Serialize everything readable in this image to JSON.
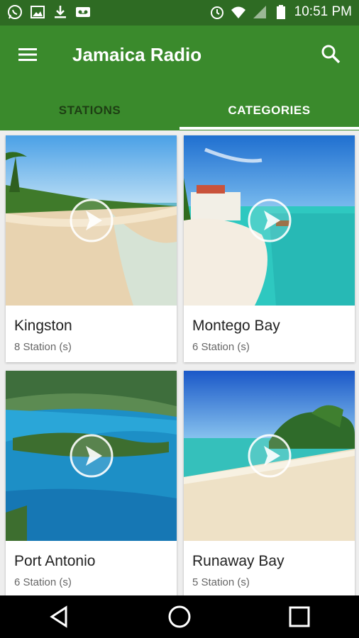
{
  "status_bar": {
    "time": "10:51 PM",
    "left_icons": [
      "whatsapp-icon",
      "gallery-icon",
      "download-icon",
      "voicemail-icon"
    ],
    "right_icons": [
      "alarm-icon",
      "wifi-icon",
      "signal-icon",
      "battery-icon"
    ]
  },
  "app_bar": {
    "title": "Jamaica Radio",
    "menu_icon": "menu-icon",
    "search_icon": "search-icon"
  },
  "tabs": [
    {
      "label": "STATIONS",
      "active": false
    },
    {
      "label": "CATEGORIES",
      "active": true
    }
  ],
  "colors": {
    "status_bar": "#2e6b23",
    "app_bar": "#3a8a2c",
    "active_tab_text": "#ffffff",
    "inactive_tab_text": "#1e3e14",
    "background": "#eeeeee"
  },
  "categories": [
    {
      "name": "Kingston",
      "count": "8 Station (s)"
    },
    {
      "name": "Montego Bay",
      "count": "6 Station (s)"
    },
    {
      "name": "Port Antonio",
      "count": "6 Station (s)"
    },
    {
      "name": "Runaway Bay",
      "count": "5 Station (s)"
    }
  ],
  "nav_bar": {
    "icons": [
      "back-icon",
      "home-icon",
      "recents-icon"
    ]
  }
}
